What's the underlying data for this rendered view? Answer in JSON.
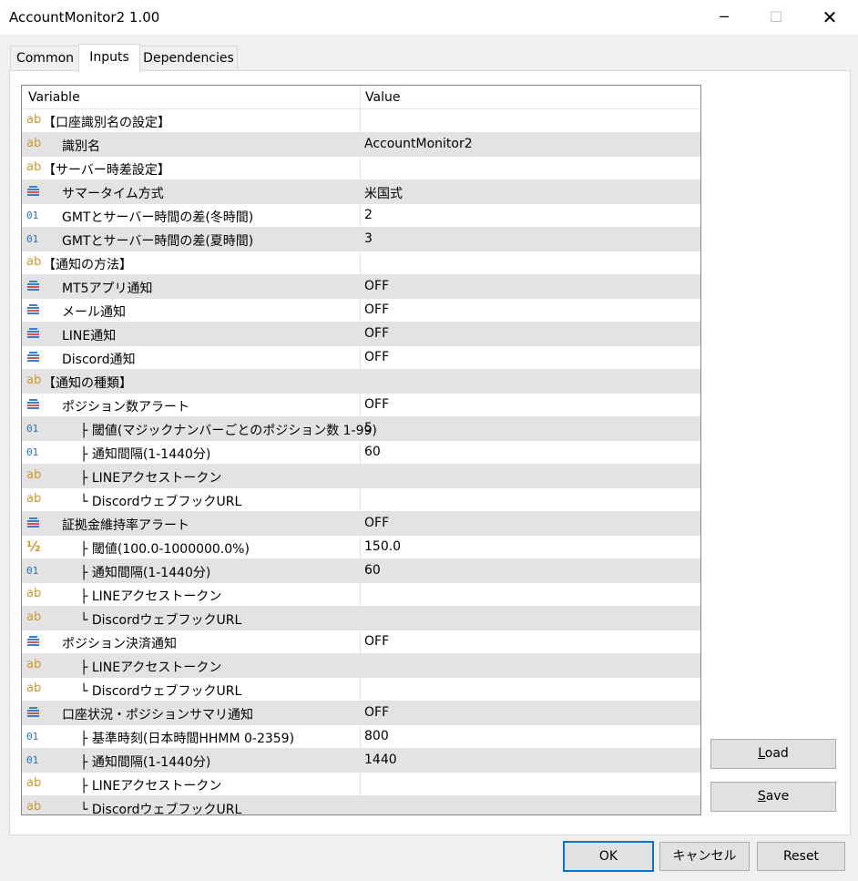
{
  "window": {
    "title": "AccountMonitor2 1.00",
    "minimize_glyph": "─",
    "maximize_glyph": "☐",
    "close_glyph": "✕"
  },
  "tabs": [
    {
      "label": "Common",
      "active": false
    },
    {
      "label": "Inputs",
      "active": true
    },
    {
      "label": "Dependencies",
      "active": false
    }
  ],
  "grid": {
    "header": {
      "variable": "Variable",
      "value": "Value"
    },
    "rows": [
      {
        "icon": "ab",
        "indent": 0,
        "label": "【口座識別名の設定】",
        "value": ""
      },
      {
        "icon": "ab",
        "indent": 1,
        "label": "識別名",
        "value": "AccountMonitor2"
      },
      {
        "icon": "ab",
        "indent": 0,
        "label": "【サーバー時差設定】",
        "value": ""
      },
      {
        "icon": "enum",
        "indent": 1,
        "label": "サマータイム方式",
        "value": "米国式"
      },
      {
        "icon": "01",
        "indent": 1,
        "label": "GMTとサーバー時間の差(冬時間)",
        "value": "2"
      },
      {
        "icon": "01",
        "indent": 1,
        "label": "GMTとサーバー時間の差(夏時間)",
        "value": "3"
      },
      {
        "icon": "ab",
        "indent": 0,
        "label": "【通知の方法】",
        "value": ""
      },
      {
        "icon": "enum",
        "indent": 1,
        "label": "MT5アプリ通知",
        "value": "OFF"
      },
      {
        "icon": "enum",
        "indent": 1,
        "label": "メール通知",
        "value": "OFF"
      },
      {
        "icon": "enum",
        "indent": 1,
        "label": "LINE通知",
        "value": "OFF"
      },
      {
        "icon": "enum",
        "indent": 1,
        "label": "Discord通知",
        "value": "OFF"
      },
      {
        "icon": "ab",
        "indent": 0,
        "label": "【通知の種類】",
        "value": ""
      },
      {
        "icon": "enum",
        "indent": 1,
        "label": "ポジション数アラート",
        "value": "OFF"
      },
      {
        "icon": "01",
        "indent": 2,
        "label": "├ 閾値(マジックナンバーごとのポジション数 1-99)",
        "value": "5"
      },
      {
        "icon": "01",
        "indent": 2,
        "label": "├ 通知間隔(1-1440分)",
        "value": "60"
      },
      {
        "icon": "ab",
        "indent": 2,
        "label": "├ LINEアクセストークン",
        "value": ""
      },
      {
        "icon": "ab",
        "indent": 2,
        "label": "└ DiscordウェブフックURL",
        "value": ""
      },
      {
        "icon": "enum",
        "indent": 1,
        "label": "証拠金維持率アラート",
        "value": "OFF"
      },
      {
        "icon": "half",
        "indent": 2,
        "label": "├ 閾値(100.0-1000000.0%)",
        "value": "150.0"
      },
      {
        "icon": "01",
        "indent": 2,
        "label": "├ 通知間隔(1-1440分)",
        "value": "60"
      },
      {
        "icon": "ab",
        "indent": 2,
        "label": "├ LINEアクセストークン",
        "value": ""
      },
      {
        "icon": "ab",
        "indent": 2,
        "label": "└ DiscordウェブフックURL",
        "value": ""
      },
      {
        "icon": "enum",
        "indent": 1,
        "label": "ポジション決済通知",
        "value": "OFF"
      },
      {
        "icon": "ab",
        "indent": 2,
        "label": "├ LINEアクセストークン",
        "value": ""
      },
      {
        "icon": "ab",
        "indent": 2,
        "label": "└ DiscordウェブフックURL",
        "value": ""
      },
      {
        "icon": "enum",
        "indent": 1,
        "label": "口座状況・ポジションサマリ通知",
        "value": "OFF"
      },
      {
        "icon": "01",
        "indent": 2,
        "label": "├ 基準時刻(日本時間HHMM 0-2359)",
        "value": "800"
      },
      {
        "icon": "01",
        "indent": 2,
        "label": "├ 通知間隔(1-1440分)",
        "value": "1440"
      },
      {
        "icon": "ab",
        "indent": 2,
        "label": "├ LINEアクセストークン",
        "value": ""
      },
      {
        "icon": "ab",
        "indent": 2,
        "label": "└ DiscordウェブフックURL",
        "value": ""
      }
    ]
  },
  "buttons": {
    "load_first": "L",
    "load_rest": "oad",
    "save_first": "S",
    "save_rest": "ave",
    "ok": "OK",
    "cancel": "キャンセル",
    "reset": "Reset"
  },
  "icon_glyphs": {
    "ab": "ab",
    "01": "01",
    "half": "½"
  },
  "colors": {
    "accent": "#0078d7",
    "row_alt": "#e3e3e3",
    "icon_string": "#c69a31",
    "icon_int": "#2f6fb5"
  }
}
